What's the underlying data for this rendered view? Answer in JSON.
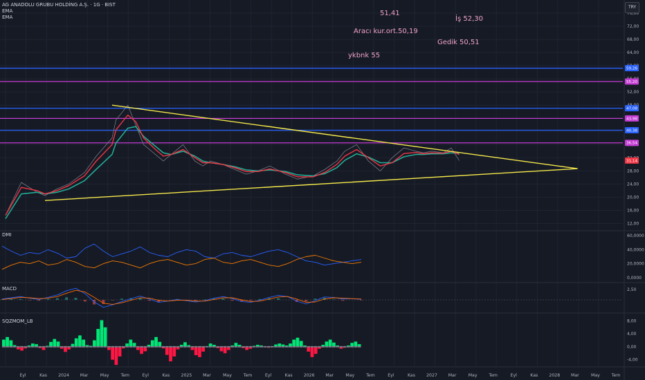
{
  "header": {
    "symbol_line": "AG ANADOLU GRUBU HOLDİNG A.Ş. · 1G · BIST",
    "indicator_1": "EMA",
    "indicator_2": "EMA"
  },
  "currency_badge": "TRY",
  "annotations": [
    {
      "text": "51,41"
    },
    {
      "text": "İş 52,30"
    },
    {
      "text": "Aracı kur.ort.50,19"
    },
    {
      "text": "Gedik 50,51"
    },
    {
      "text": "ykbnk 55"
    }
  ],
  "panes": {
    "dmi_label": "DMI",
    "macd_label": "MACD",
    "sqz_label": "SQZMOM_LB"
  },
  "colors": {
    "background": "#161a25",
    "grid": "#1f2431",
    "price": "#787b86",
    "ema_fast": "#f23645",
    "ema_slow": "#22ab94",
    "trendline": "#f5e94b",
    "hline_blue": "#2962ff",
    "hline_magenta": "#c43bd4",
    "dmi_plus": "#2962ff",
    "dmi_minus": "#f57c00",
    "macd_line": "#2962ff",
    "signal_line": "#ff6d00",
    "sqz_up": "#00e676",
    "sqz_down": "#ff1744"
  },
  "chart_data": [
    {
      "type": "line",
      "pane": "price",
      "title": "AG ANADOLU GRUBU HOLDİNG A.Ş. · 1G · BIST",
      "x_tick_labels": [
        "Eyl",
        "Kas",
        "2024",
        "Mar",
        "May",
        "Tem",
        "Eyl",
        "Kas",
        "2025",
        "Mar",
        "May",
        "Tem",
        "Eyl",
        "Kas",
        "2026",
        "Mar",
        "May",
        "Tem",
        "Eyl",
        "Kas",
        "2027",
        "Mar",
        "May",
        "Tem",
        "Eyl",
        "Kas",
        "2028",
        "Mar",
        "May",
        "Tem"
      ],
      "y_ticks": [
        12,
        16,
        20,
        24,
        28,
        32,
        36,
        40,
        44,
        48,
        52,
        56,
        60,
        64,
        68,
        72,
        76
      ],
      "y_tick_labels": [
        "12,00",
        "16,00",
        "20,00",
        "24,00",
        "28,00",
        "32,00",
        "36,00",
        "40,00",
        "44,00",
        "48,00",
        "52,00",
        "56,00",
        "60,00",
        "64,00",
        "68,00",
        "72,00",
        "76,00"
      ],
      "ylim": [
        10,
        80
      ],
      "price_series": {
        "name": "Close",
        "x_index": [
          0,
          4,
          8,
          10,
          13,
          16,
          20,
          23,
          27,
          28,
          31,
          33,
          35,
          38,
          40,
          42,
          45,
          48,
          50,
          52,
          55,
          58,
          61,
          64,
          67,
          71,
          74,
          78,
          81,
          84,
          86,
          89,
          92,
          95,
          98,
          101,
          104,
          106,
          108,
          111,
          113,
          115
        ],
        "values": [
          14.5,
          24.5,
          21.5,
          20.5,
          22.5,
          24,
          27.5,
          32.5,
          38,
          43.5,
          48,
          42,
          36,
          33,
          31,
          33,
          36,
          31,
          29.5,
          31,
          30,
          28.5,
          27,
          28,
          29.5,
          27,
          25.5,
          26.5,
          28.5,
          31,
          34,
          36,
          31,
          28,
          32,
          35,
          34,
          33.5,
          34,
          33.5,
          35,
          31.14
        ]
      },
      "ema_fast": {
        "x_index": [
          0,
          4,
          8,
          10,
          13,
          16,
          20,
          23,
          27,
          28,
          31,
          33,
          35,
          38,
          40,
          42,
          45,
          48,
          50,
          52,
          55,
          58,
          61,
          64,
          67,
          71,
          74,
          78,
          81,
          84,
          86,
          89,
          92,
          95,
          98,
          101,
          104,
          106,
          108,
          111,
          113,
          115
        ],
        "values": [
          14.5,
          23,
          22,
          21,
          22,
          23.5,
          26.5,
          31,
          36,
          40.5,
          45,
          43,
          38,
          34.5,
          32.5,
          33,
          34.5,
          32,
          30.5,
          30.5,
          30,
          29,
          27.8,
          27.8,
          28.6,
          27.5,
          26.2,
          26.2,
          27.6,
          30,
          32.5,
          34.5,
          32,
          29.5,
          30.5,
          33.3,
          33.6,
          33.2,
          33.5,
          33.4,
          34,
          33
        ]
      },
      "ema_slow": {
        "x_index": [
          0,
          4,
          8,
          10,
          13,
          16,
          20,
          23,
          27,
          28,
          31,
          33,
          35,
          38,
          40,
          42,
          45,
          48,
          50,
          52,
          55,
          58,
          61,
          64,
          67,
          71,
          74,
          78,
          81,
          84,
          86,
          89,
          92,
          95,
          98,
          101,
          104,
          106,
          108,
          111,
          113,
          115
        ],
        "values": [
          13.5,
          21,
          21.5,
          21,
          21.5,
          22.5,
          25,
          28.5,
          33,
          36.5,
          41,
          41.5,
          38.5,
          35.5,
          33.5,
          33,
          34,
          32.5,
          31,
          30.5,
          30,
          29.3,
          28.3,
          28,
          28.3,
          27.8,
          26.8,
          26.5,
          27.2,
          29,
          31.2,
          33.2,
          32.2,
          30.5,
          30.5,
          32.3,
          33,
          33,
          33.2,
          33.2,
          33.5,
          33.3
        ]
      },
      "horizontal_levels": [
        {
          "value": 59.26,
          "label": "59,26",
          "color": "#2962ff"
        },
        {
          "value": 55.2,
          "label": "55,20",
          "color": "#c43bd4"
        },
        {
          "value": 47.08,
          "label": "47,08",
          "color": "#2962ff"
        },
        {
          "value": 43.98,
          "label": "43,98",
          "color": "#c43bd4"
        },
        {
          "value": 40.38,
          "label": "40,38",
          "color": "#2962ff"
        },
        {
          "value": 36.54,
          "label": "36,54",
          "color": "#c43bd4"
        }
      ],
      "last_price": {
        "value": 31.14,
        "label": "31,14"
      },
      "trendlines": [
        {
          "from": {
            "x_index": 27,
            "value": 48
          },
          "to": {
            "x_index": 145,
            "value": 28.7
          }
        },
        {
          "from": {
            "x_index": 10,
            "value": 19
          },
          "to": {
            "x_index": 145,
            "value": 28.7
          }
        }
      ]
    },
    {
      "type": "line",
      "pane": "DMI",
      "title": "DMI",
      "y_ticks": [
        0,
        20,
        40,
        60
      ],
      "y_tick_labels": [
        "0,0000",
        "20,0000",
        "40,0000",
        "60,0000"
      ],
      "ylim": [
        -5,
        65
      ],
      "series": [
        {
          "name": "+DI",
          "values": [
            45,
            38,
            32,
            36,
            34,
            40,
            35,
            28,
            30,
            42,
            48,
            38,
            30,
            34,
            38,
            44,
            36,
            32,
            30,
            36,
            40,
            38,
            30,
            28,
            34,
            36,
            32,
            30,
            34,
            38,
            40,
            36,
            30,
            24,
            22,
            18,
            20,
            22,
            24,
            26
          ]
        },
        {
          "name": "-DI",
          "values": [
            12,
            18,
            22,
            20,
            24,
            18,
            20,
            26,
            22,
            16,
            14,
            20,
            24,
            22,
            18,
            14,
            20,
            24,
            26,
            22,
            18,
            20,
            26,
            28,
            22,
            20,
            24,
            26,
            22,
            18,
            16,
            20,
            26,
            30,
            32,
            28,
            24,
            22,
            20,
            22
          ]
        }
      ]
    },
    {
      "type": "line",
      "pane": "MACD",
      "title": "MACD",
      "y_ticks": [
        2.5
      ],
      "y_tick_labels": [
        "2,50"
      ],
      "series": [
        {
          "name": "MACD",
          "values": [
            0.2,
            0.5,
            0.8,
            0.4,
            0.1,
            0.6,
            1.2,
            2.2,
            2.8,
            1.5,
            -0.5,
            -1.8,
            -1.2,
            -0.4,
            0.3,
            0.9,
            0.2,
            -0.6,
            -0.3,
            0.1,
            -0.2,
            -0.5,
            -0.2,
            0.4,
            0.8,
            0.3,
            -0.4,
            -0.6,
            -0.1,
            0.6,
            1.1,
            0.8,
            -0.3,
            -1.0,
            -0.2,
            0.7,
            0.6,
            0.2,
            0.3,
            0.1
          ]
        },
        {
          "name": "Signal",
          "values": [
            0.1,
            0.3,
            0.6,
            0.5,
            0.3,
            0.4,
            0.8,
            1.6,
            2.3,
            1.9,
            0.6,
            -0.8,
            -1.1,
            -0.7,
            -0.1,
            0.5,
            0.4,
            -0.1,
            -0.3,
            -0.1,
            -0.1,
            -0.3,
            -0.3,
            0.1,
            0.5,
            0.5,
            0.0,
            -0.4,
            -0.3,
            0.2,
            0.7,
            0.8,
            0.2,
            -0.6,
            -0.5,
            0.2,
            0.5,
            0.4,
            0.3,
            0.2
          ]
        }
      ]
    },
    {
      "type": "bar",
      "pane": "SQZMOM_LB",
      "title": "SQZMOM_LB",
      "y_ticks": [
        -4,
        0,
        4,
        8
      ],
      "y_tick_labels": [
        "-4,00",
        "0,00",
        "4,00",
        "8,00"
      ],
      "ylim": [
        -6,
        10
      ],
      "values": [
        2.2,
        3.0,
        2.0,
        0.5,
        -0.8,
        -1.2,
        -0.5,
        0.4,
        1.0,
        0.8,
        -0.4,
        -1.0,
        0.3,
        1.5,
        2.4,
        1.6,
        -0.6,
        -1.6,
        -0.8,
        0.9,
        2.6,
        3.5,
        2.2,
        0.5,
        0.3,
        2.0,
        5.5,
        8.2,
        6.0,
        -1.0,
        -4.0,
        -5.6,
        -3.0,
        -0.5,
        1.0,
        2.2,
        1.2,
        -1.0,
        -2.2,
        -1.4,
        0.6,
        2.0,
        3.0,
        1.5,
        -0.5,
        -2.5,
        -4.5,
        -3.0,
        -0.8,
        0.6,
        1.4,
        0.5,
        -1.0,
        -2.6,
        -3.2,
        -1.5,
        0.2,
        1.0,
        0.6,
        -0.4,
        -1.4,
        -2.0,
        -1.0,
        0.4,
        1.2,
        0.6,
        -0.4,
        -1.0,
        -0.6,
        0.3,
        0.6,
        0.4,
        0.0,
        -0.3,
        0.2,
        0.7,
        1.0,
        0.7,
        0.4,
        1.0,
        2.2,
        2.8,
        1.8,
        0.4,
        -1.5,
        -3.2,
        -2.2,
        -0.6,
        0.6,
        1.6,
        2.2,
        1.3,
        0.4,
        -0.6,
        -0.3,
        0.4,
        1.2,
        1.6,
        0.8
      ]
    }
  ]
}
